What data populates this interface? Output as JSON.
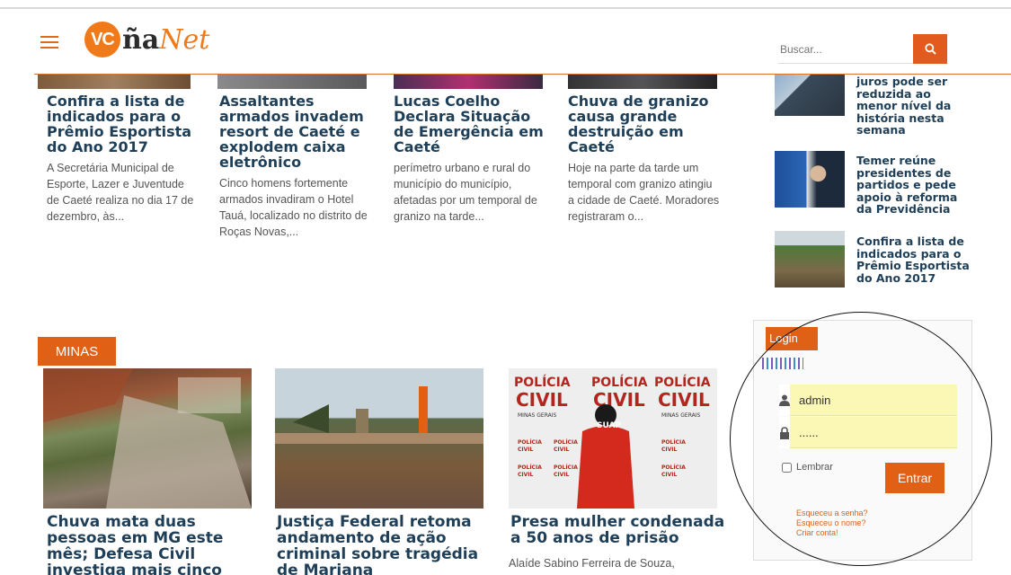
{
  "header": {
    "logo": "VCñaNet",
    "search": {
      "placeholder": "Buscar..."
    }
  },
  "top_articles": [
    {
      "title": "Confira a lista de indicados para o Prêmio Esportista do Ano 2017",
      "excerpt": " A Secretária Municipal de Esporte, Lazer e Juventude de Caeté realiza no dia 17 de dezembro, às..."
    },
    {
      "title": "Assaltantes armados invadem resort de Caeté e explodem caixa eletrônico",
      "excerpt": "Cinco homens fortemente armados invadiram o Hotel Tauá, localizado  no distrito de Roças Novas,..."
    },
    {
      "title": "Lucas Coelho Declara Situação de Emergência em Caeté",
      "excerpt": " perímetro urbano e rural do município do município, afetadas por um temporal de granizo na tarde..."
    },
    {
      "title": "Chuva de granizo causa grande destruição em Caeté",
      "excerpt": "Hoje na parte da tarde um temporal com granizo atingiu a cidade de Caeté. Moradores registraram o..."
    }
  ],
  "sidebar_news": [
    {
      "title": "juros pode ser reduzida ao menor nível da história nesta semana"
    },
    {
      "title": "Temer reúne presidentes de partidos e pede apoio à reforma da Previdência"
    },
    {
      "title": "Confira a lista de indicados para o Prêmio Esportista do Ano 2017"
    }
  ],
  "minas": {
    "tab_label": "MINAS",
    "articles": [
      {
        "title": "Chuva mata duas pessoas em MG este mês; Defesa Civil investiga mais cinco casos",
        "excerpt": ""
      },
      {
        "title": "Justiça Federal retoma andamento de ação criminal sobre tragédia de Mariana",
        "excerpt": ""
      },
      {
        "title": "Presa mulher condenada a 50 anos de prisão",
        "excerpt": "Alaíde Sabino Ferreira de Souza,"
      }
    ],
    "image_texts": {
      "policia": "POLÍCIA",
      "civil": "CIVIL",
      "minas_gerais": "MINAS GERAIS",
      "suap": "SUAP"
    }
  },
  "login": {
    "tab_label": "Login",
    "username_value": "admin",
    "password_value": "......",
    "remember_label": "Lembrar",
    "submit_label": "Entrar",
    "links": [
      "Esqueceu a senha?",
      "Esqueceu o nome?",
      "Criar conta!"
    ]
  },
  "colors": {
    "accent": "#e06016",
    "title": "#1e3f57",
    "field_fill": "#fbf7b5"
  }
}
